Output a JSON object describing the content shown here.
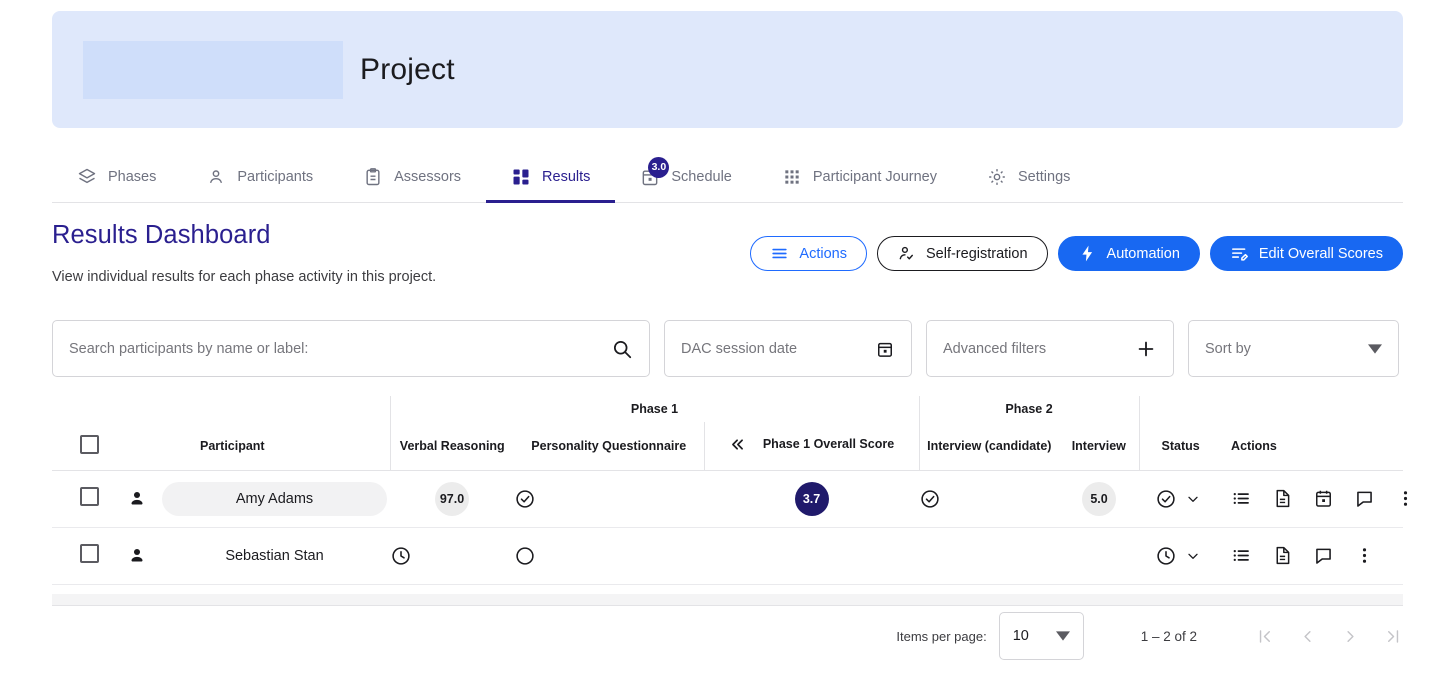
{
  "banner": {
    "logo_placeholder": "logo-placeholder",
    "title": "Project"
  },
  "tabs": [
    {
      "label": "Phases",
      "icon": "layers-icon",
      "active": false,
      "badge": null
    },
    {
      "label": "Participants",
      "icon": "person-icon",
      "active": false,
      "badge": null
    },
    {
      "label": "Assessors",
      "icon": "clipboard-icon",
      "active": false,
      "badge": null
    },
    {
      "label": "Results",
      "icon": "dashboard-icon",
      "active": true,
      "badge": null
    },
    {
      "label": "Schedule",
      "icon": "calendar-icon",
      "active": false,
      "badge": "3.0"
    },
    {
      "label": "Participant Journey",
      "icon": "grid-dots-icon",
      "active": false,
      "badge": null
    },
    {
      "label": "Settings",
      "icon": "gear-icon",
      "active": false,
      "badge": null
    }
  ],
  "header": {
    "title": "Results Dashboard",
    "subtitle": "View individual results for each phase activity in this project."
  },
  "toolbar": {
    "actions_label": "Actions",
    "self_registration_label": "Self-registration",
    "automation_label": "Automation",
    "edit_overall_scores_label": "Edit Overall Scores"
  },
  "filters": {
    "search_placeholder": "Search participants by name or label:",
    "search_value": "",
    "date_label": "DAC session date",
    "advanced_label": "Advanced filters",
    "sort_label": "Sort by"
  },
  "table": {
    "groups": [
      {
        "label": "Phase 1"
      },
      {
        "label": "Phase 2"
      }
    ],
    "columns": [
      "Participant",
      "Verbal Reasoning",
      "Personality Questionnaire",
      "Phase 1 Overall Score",
      "Interview (candidate)",
      "Interview",
      "Status",
      "Actions"
    ],
    "rows": [
      {
        "participant": "Amy Adams",
        "highlighted": true,
        "verbal_reasoning": "97.0",
        "personality_questionnaire": "check-circle-icon",
        "phase1_overall_score": "3.7",
        "interview_candidate": "check-circle-icon",
        "interview": "5.0",
        "status": "check-circle-icon",
        "actions": [
          "list-icon",
          "document-icon",
          "calendar-icon",
          "comment-icon",
          "more-vert-icon"
        ]
      },
      {
        "participant": "Sebastian Stan",
        "highlighted": false,
        "verbal_reasoning": "clock-icon",
        "personality_questionnaire": "empty-circle-icon",
        "phase1_overall_score": "",
        "interview_candidate": "",
        "interview": "",
        "status": "clock-icon",
        "actions": [
          "list-icon",
          "document-icon",
          "comment-icon",
          "more-vert-icon"
        ]
      }
    ]
  },
  "paginator": {
    "items_per_page_label": "Items per page:",
    "items_per_page_value": "10",
    "range_label": "1 – 2 of 2",
    "first_icon": "first-page-icon",
    "prev_icon": "prev-page-icon",
    "next_icon": "next-page-icon",
    "last_icon": "last-page-icon"
  },
  "colors": {
    "brand_navy": "#2a1f8f",
    "badge_navy": "#201a6b",
    "accent_blue": "#1868f2",
    "banner_bg": "#dfe8fb",
    "logo_bg": "#cfdefa"
  }
}
